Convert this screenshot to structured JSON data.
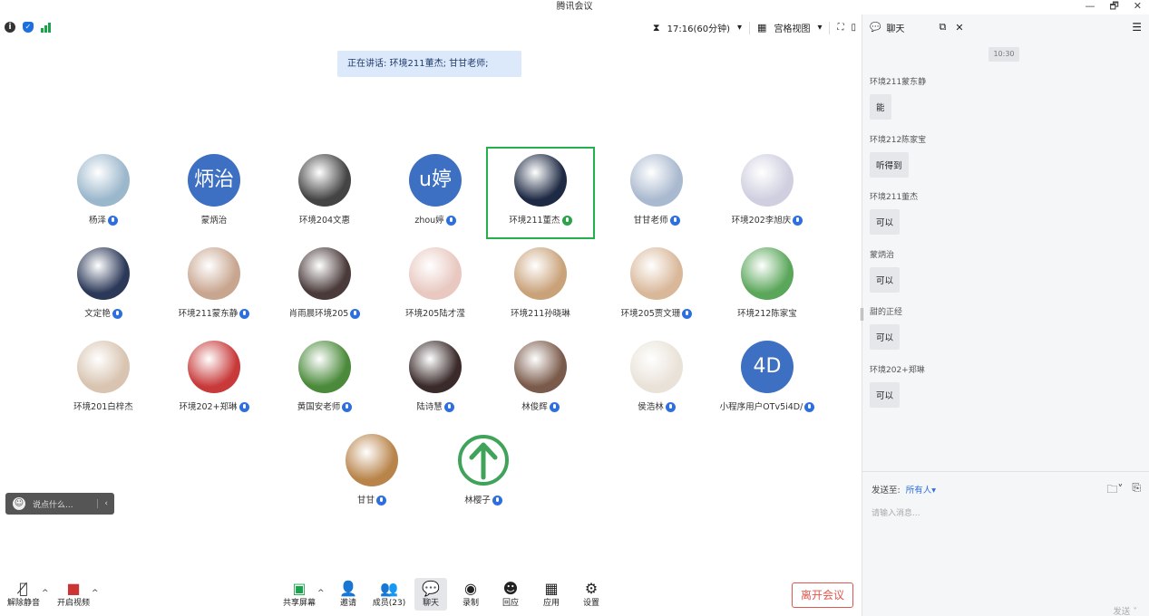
{
  "window": {
    "title": "腾讯会议",
    "controls": [
      "—",
      "🗗",
      "✕"
    ]
  },
  "topbar": {
    "timer": "17:16(60分钟)",
    "view_label": "宫格视图"
  },
  "speaking_banner": "正在讲话: 环境211董杰; 甘甘老师;",
  "participants": [
    {
      "name": "杨泽",
      "avatar": "photo",
      "color": "#9bb7cc"
    },
    {
      "name": "蒙炳治",
      "avatar": "炳治"
    },
    {
      "name": "环境204文惠",
      "avatar": "photo",
      "color": "#444"
    },
    {
      "name": "zhou婷",
      "avatar": "u婷"
    },
    {
      "name": "环境211董杰",
      "avatar": "photo",
      "color": "#1e2a44"
    },
    {
      "name": "甘甘老师",
      "avatar": "photo",
      "color": "#a9b9cf"
    },
    {
      "name": "环境202李旭庆",
      "avatar": "photo",
      "color": "#cfcfe0"
    },
    {
      "name": "文定艳",
      "avatar": "photo",
      "color": "#2b3858"
    },
    {
      "name": "环境211蒙东静",
      "avatar": "photo",
      "color": "#c8a58f"
    },
    {
      "name": "肖雨晨环境205",
      "avatar": "photo",
      "color": "#4a3a3a"
    },
    {
      "name": "环境205陆才滢",
      "avatar": "photo",
      "color": "#e8c8c0"
    },
    {
      "name": "环境211孙晓琳",
      "avatar": "photo",
      "color": "#c9a27a"
    },
    {
      "name": "环境205贾文珊",
      "avatar": "photo",
      "color": "#d9b89a"
    },
    {
      "name": "环境212陈家宝",
      "avatar": "photo",
      "color": "#5aa65a"
    },
    {
      "name": "环境201白梓杰",
      "avatar": "photo",
      "color": "#d8c4b0"
    },
    {
      "name": "环境202+郑琳",
      "avatar": "photo",
      "color": "#c83a3a"
    },
    {
      "name": "黄国安老师",
      "avatar": "photo",
      "color": "#4a8a3a"
    },
    {
      "name": "陆诗慧",
      "avatar": "photo",
      "color": "#3a2a2a"
    },
    {
      "name": "林俊辉",
      "avatar": "photo",
      "color": "#7a5a4a"
    },
    {
      "name": "侯浩林",
      "avatar": "photo",
      "color": "#e9e2d8"
    },
    {
      "name": "小程序用户OTv5i4D/",
      "avatar": "4D"
    },
    {
      "name": "甘甘",
      "avatar": "photo",
      "color": "#b8844a"
    },
    {
      "name": "林樱子",
      "avatar": "arrow"
    }
  ],
  "say_box": {
    "placeholder": "说点什么...",
    "chevron": "‹"
  },
  "toolbar": {
    "unmute": "解除静音",
    "start_video": "开启视频",
    "share_screen": "共享屏幕",
    "invite": "邀请",
    "members": "成员(23)",
    "chat": "聊天",
    "record": "录制",
    "react": "回应",
    "apps": "应用",
    "settings": "设置",
    "leave": "离开会议"
  },
  "chat": {
    "title": "聊天",
    "time": "10:30",
    "messages": [
      {
        "sender": "环境211蒙东静",
        "text": "能"
      },
      {
        "sender": "环境212陈家宝",
        "text": "听得到"
      },
      {
        "sender": "环境211董杰",
        "text": "可以"
      },
      {
        "sender": "蒙炳治",
        "text": "可以"
      },
      {
        "sender": "甜的正经",
        "text": "可以"
      },
      {
        "sender": "环境202+郑琳",
        "text": "可以"
      }
    ],
    "send_to_label": "发送至:",
    "send_to_value": "所有人▾",
    "input_placeholder": "请输入消息...",
    "send_label": "发送"
  }
}
